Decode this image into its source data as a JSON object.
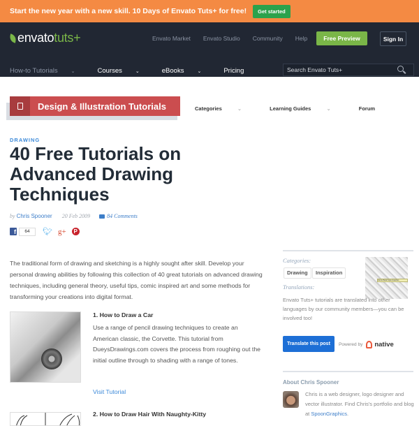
{
  "promo": {
    "text": "Start the new year with a new skill. 10 Days of Envato Tuts+ for free!",
    "button": "Get started"
  },
  "header": {
    "logo_main": "envato",
    "logo_accent": "tuts+",
    "links": [
      "Envato Market",
      "Envato Studio",
      "Community",
      "Help"
    ],
    "free_preview": "Free Preview",
    "sign_in": "Sign In",
    "nav": [
      {
        "label": "How-to Tutorials",
        "caret": "⌄"
      },
      {
        "label": "Courses",
        "caret": "⌄"
      },
      {
        "label": "eBooks",
        "caret": "⌄"
      },
      {
        "label": "Pricing",
        "caret": ""
      }
    ],
    "search_placeholder": "Search Envato Tuts+"
  },
  "category": {
    "title": "Design & Illustration Tutorials",
    "subnav": [
      {
        "label": "Categories",
        "caret": "⌄"
      },
      {
        "label": "Learning Guides",
        "caret": "⌄"
      },
      {
        "label": "Forum",
        "caret": ""
      }
    ]
  },
  "article": {
    "kicker": "DRAWING",
    "title": "40 Free Tutorials on Advanced Drawing Techniques",
    "by": "by",
    "author": "Chris Spooner",
    "date": "20 Feb 2009",
    "comments": "84 Comments",
    "facebook_count": "64",
    "intro": "The traditional form of drawing and sketching is a highly sought after skill. Develop your personal drawing abilities by following this collection of 40 great tutorials on advanced drawing techniques, including general theory, useful tips, comic inspired art and some methods for transforming your creations into digital format.",
    "items": [
      {
        "title": "1. How to Draw a Car",
        "description": "Use a range of pencil drawing techniques to create an American classic, the Corvette. This tutorial from DueysDrawings.com covers the process from roughing out the initial outline through to shading with a range of tones.",
        "link": "Visit Tutorial"
      },
      {
        "title": "2. How to Draw Hair With Naughty-Kitty"
      }
    ]
  },
  "sidebar": {
    "categories_label": "Categories:",
    "tags": [
      "Drawing",
      "Inspiration"
    ],
    "thumb_caption": "Comic Book Style Graphics",
    "translations_label": "Translations:",
    "translations_text": "Envato Tuts+ tutorials are translated into other languages by our community members—you can be involved too!",
    "translate_button": "Translate this post",
    "powered_by": "Powered by",
    "native": "native",
    "about_title": "About Chris Spooner",
    "about_text": "Chris is a web designer, logo designer and vector illustrator. Find Chris's portfolio and blog at ",
    "about_link": "SpoonGraphics",
    "about_end": "."
  }
}
